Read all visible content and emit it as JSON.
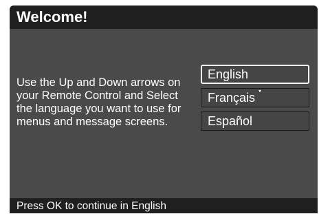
{
  "header": {
    "title": "Welcome!"
  },
  "main": {
    "instructions": "Use the Up and Down arrows on your Remote Control and Select the language you want to use for menus and message screens."
  },
  "languages": {
    "options": [
      {
        "label": "English",
        "selected": true
      },
      {
        "label": "Français",
        "selected": false
      },
      {
        "label": "Español",
        "selected": false
      }
    ]
  },
  "footer": {
    "status": "Press OK to continue in English"
  },
  "colors": {
    "panel_background": "#4a4a4a",
    "bar_background": "#1f1f1f",
    "text": "#ffffff",
    "selection_border": "#ffffff"
  }
}
